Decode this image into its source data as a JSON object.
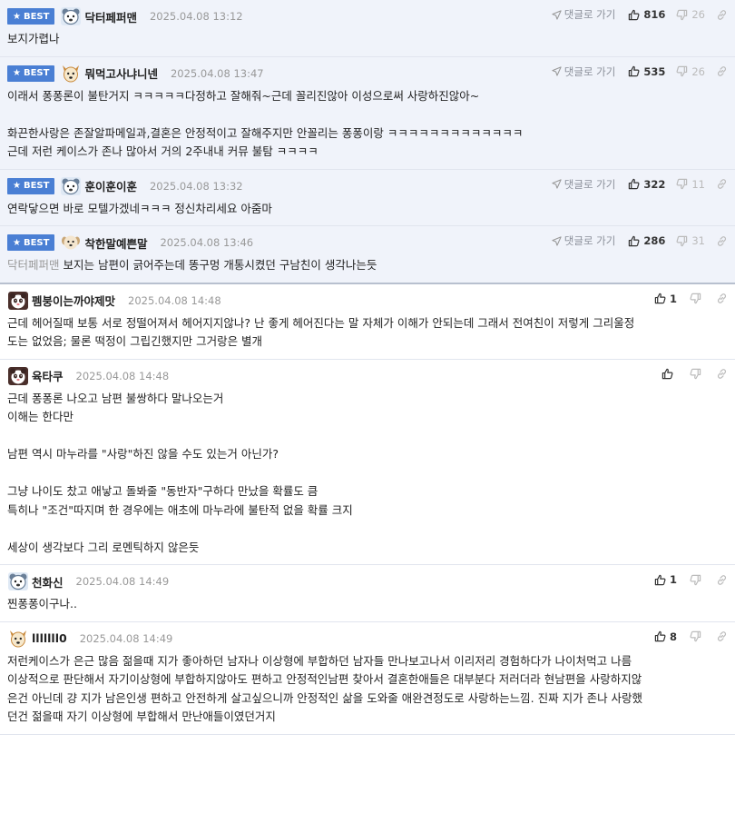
{
  "labels": {
    "best": "BEST",
    "reply": "댓글로 가기"
  },
  "colors": {
    "best_badge": "#4a7fd4",
    "best_bg": "#f0f3fa",
    "date": "#999999"
  },
  "comments": [
    {
      "best": true,
      "avatar": "bear-avatar",
      "nick": "닥터페퍼맨",
      "date": "2025.04.08 13:12",
      "up": "816",
      "down": "26",
      "mention": "",
      "body": "보지가렵나"
    },
    {
      "best": true,
      "avatar": "dog-avatar",
      "nick": "뭐먹고사냐니넨",
      "date": "2025.04.08 13:47",
      "up": "535",
      "down": "26",
      "mention": "",
      "body": "이래서 퐁퐁론이 불탄거지 ㅋㅋㅋㅋㅋ다정하고 잘해줘~근데 꼴리진않아 이성으로써 사랑하진않아~\n\n화끈한사랑은 존잘알파메일과,결혼은 안정적이고 잘해주지만 안꼴리는 퐁퐁이랑 ㅋㅋㅋㅋㅋㅋㅋㅋㅋㅋㅋㅋㅋ\n근데 저런 케이스가 존나 많아서 거의 2주내내 커뮤 불탐 ㅋㅋㅋㅋ"
    },
    {
      "best": true,
      "avatar": "bear-avatar",
      "nick": "훈이훈이훈",
      "date": "2025.04.08 13:32",
      "up": "322",
      "down": "11",
      "mention": "",
      "body": "연락닿으면 바로 모텔가겠네ㅋㅋㅋ 정신차리세요 아줌마"
    },
    {
      "best": true,
      "avatar": "puppy-avatar",
      "nick": "착한말예쁜말",
      "date": "2025.04.08 13:46",
      "up": "286",
      "down": "31",
      "mention": "닥터페퍼맨",
      "body": "보지는 남편이 긁어주는데 똥구멍 개통시켰던 구남친이 생각나는듯"
    },
    {
      "best": false,
      "avatar": "panda-avatar",
      "nick": "펨붕이는까야제맛",
      "date": "2025.04.08 14:48",
      "up": "1",
      "down": "",
      "mention": "",
      "body": "근데 헤어질때 보통 서로 정떨어져서 헤어지지않나? 난 좋게 헤어진다는 말 자체가 이해가 안되는데 그래서 전여친이 저렇게 그리울정\n도는 없었음; 물론 떡정이 그립긴했지만 그거랑은 별개"
    },
    {
      "best": false,
      "avatar": "panda-avatar",
      "nick": "육타쿠",
      "date": "2025.04.08 14:48",
      "up": "",
      "down": "",
      "mention": "",
      "body": "근데 퐁퐁론 나오고 남편 불쌍하다 말나오는거\n이해는 한다만\n\n남편 역시 마누라를 \"사랑\"하진 않을 수도 있는거 아닌가?\n\n그냥 나이도 찼고 애낳고 돌봐줄 \"동반자\"구하다 만났을 확률도 큼\n특히나 \"조건\"따지며 한 경우에는 애초에 마누라에 불탄적 없을 확률 크지\n\n세상이 생각보다 그리 로멘틱하지 않은듯"
    },
    {
      "best": false,
      "avatar": "bear-avatar",
      "nick": "천화신",
      "date": "2025.04.08 14:49",
      "up": "1",
      "down": "",
      "mention": "",
      "body": "찐퐁퐁이구나.."
    },
    {
      "best": false,
      "avatar": "dog-avatar",
      "nick": "lllllll0",
      "date": "2025.04.08 14:49",
      "up": "8",
      "down": "",
      "mention": "",
      "body": "저런케이스가 은근 많음 젊을때 지가 좋아하던 남자나 이상형에 부합하던 남자들 만나보고나서 이리저리 경험하다가 나이처먹고 나름\n이상적으로 판단해서 자기이상형에 부합하지않아도 편하고 안정적인남편 찾아서 결혼한애들은 대부분다 저러더라 현남편을 사랑하지않\n은건 아닌데 걍 지가 남은인생 편하고 안전하게 살고싶으니까 안정적인 삶을 도와줄 애완견정도로 사랑하는느낌. 진짜 지가 존나 사랑했\n던건 젊을때 자기 이상형에 부합해서 만난애들이였던거지"
    }
  ]
}
